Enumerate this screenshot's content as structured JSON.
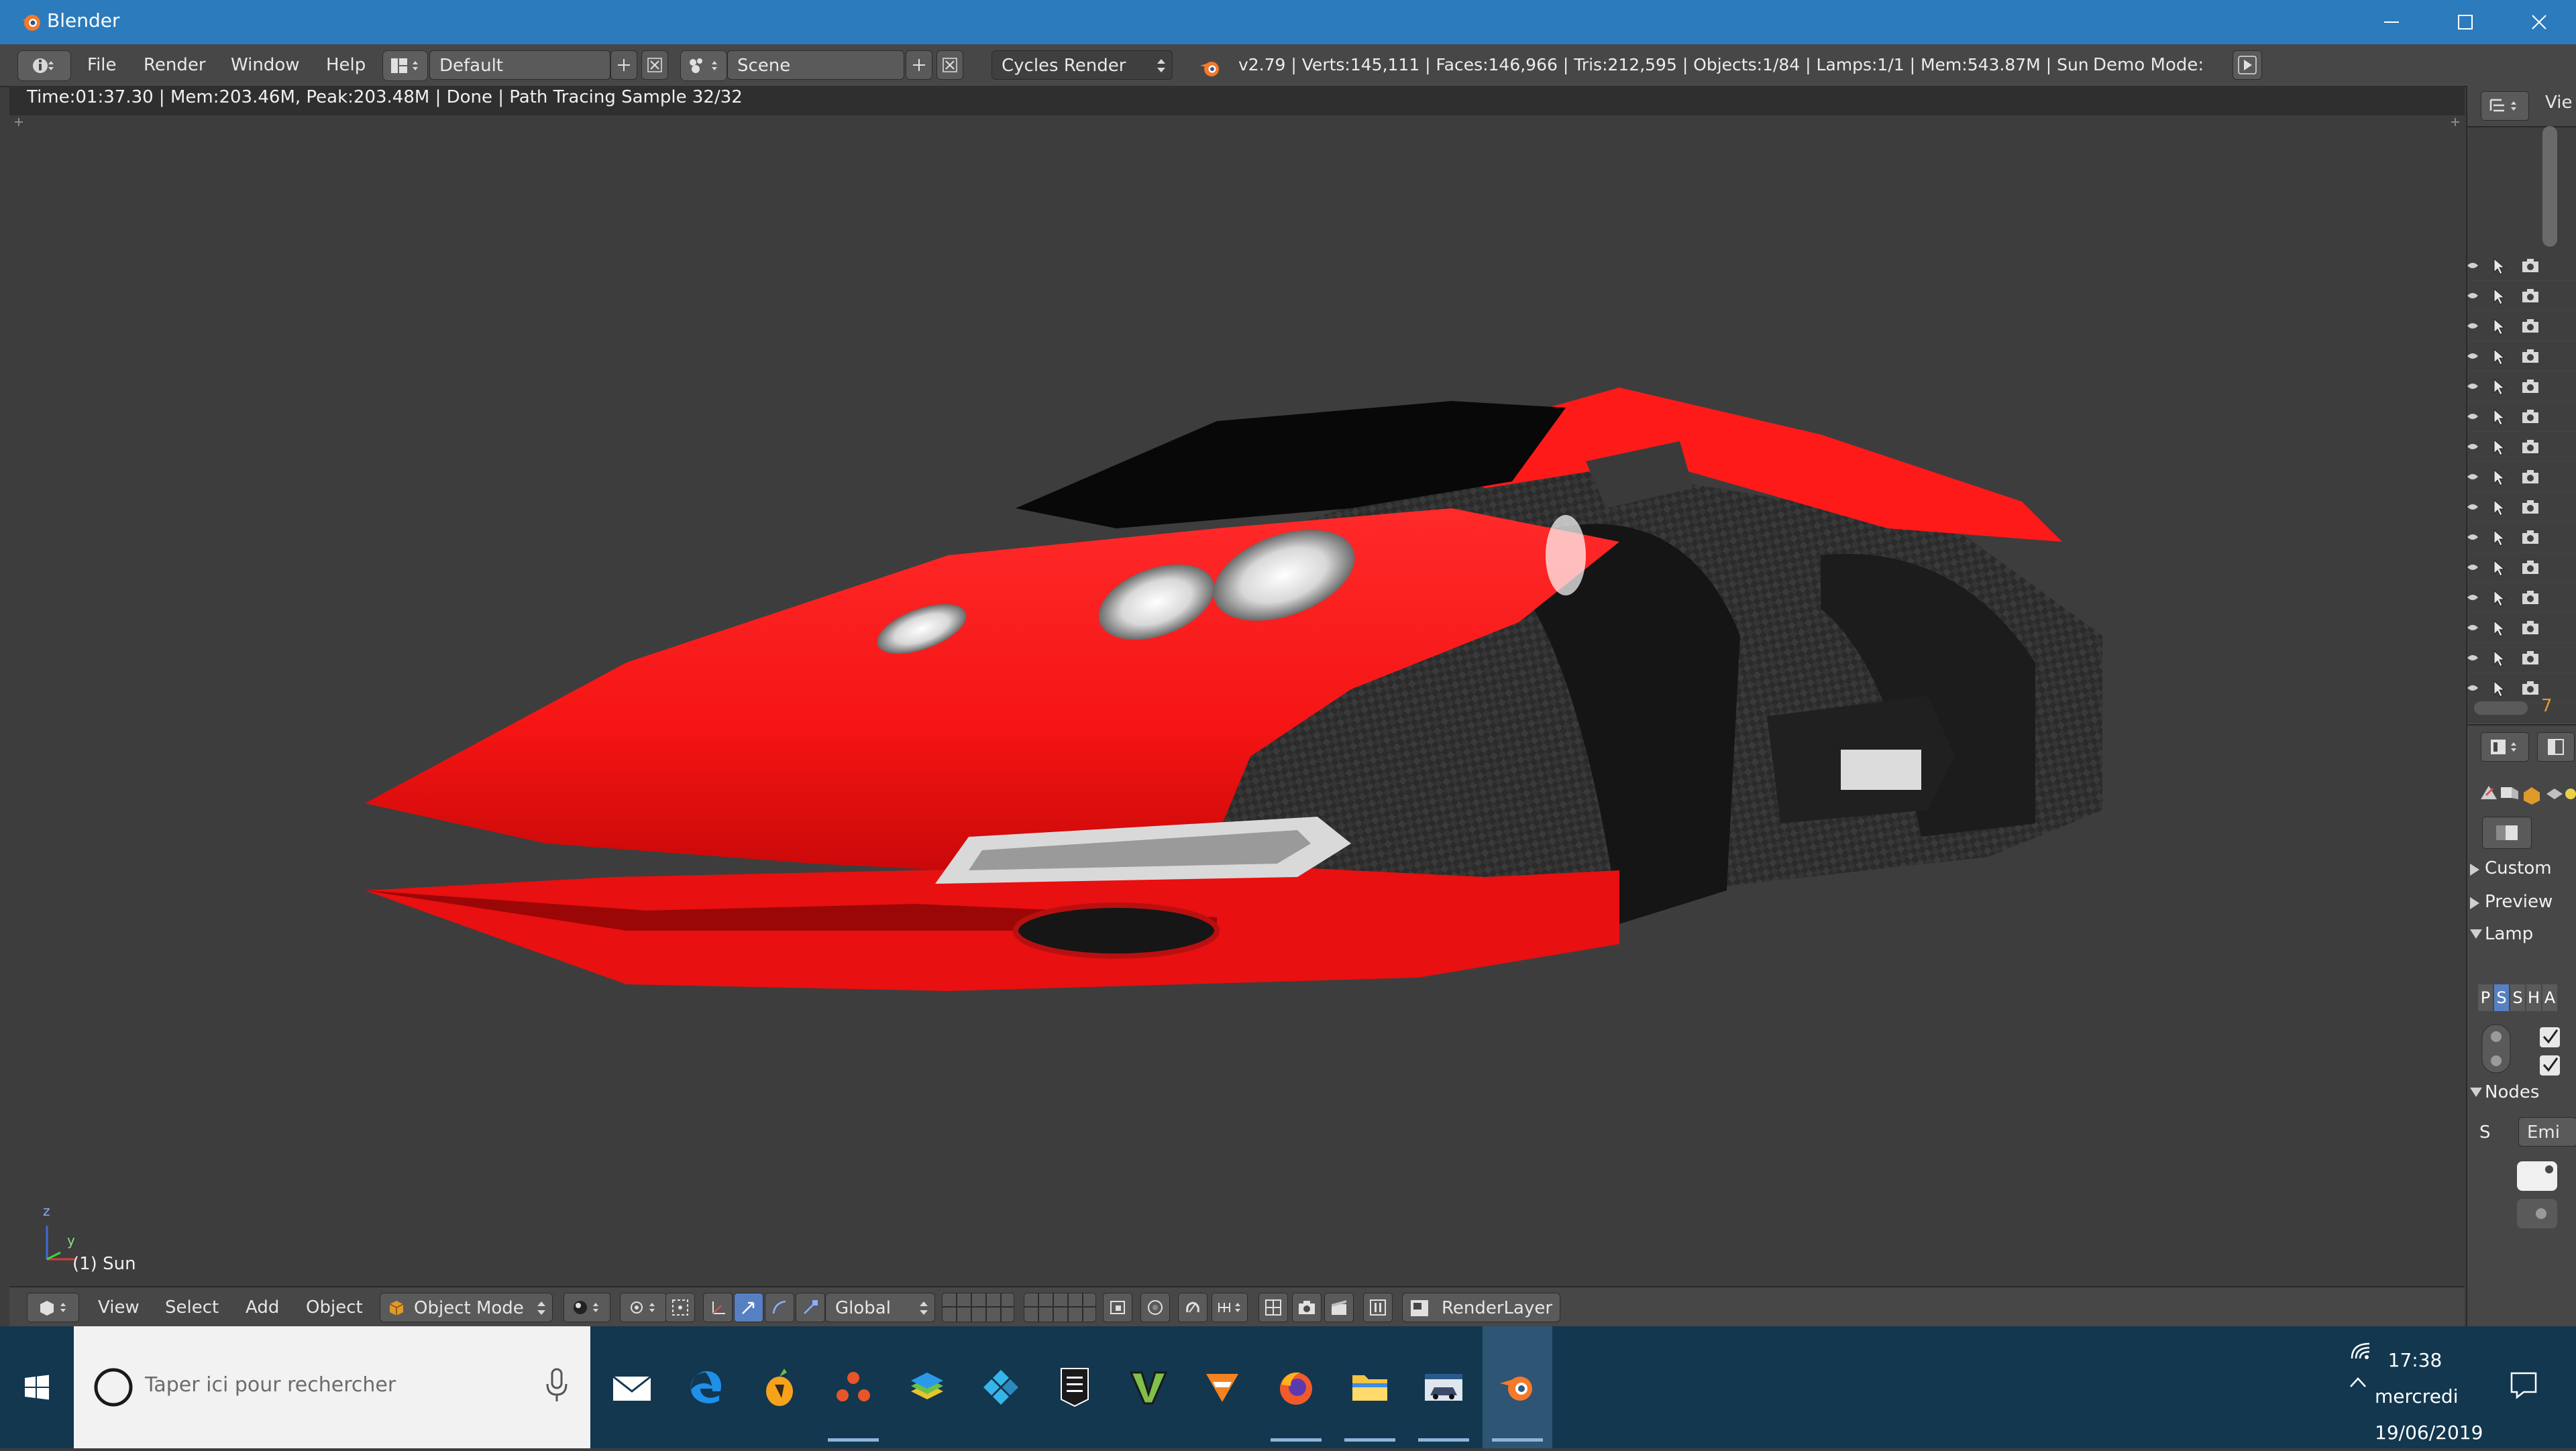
{
  "window": {
    "title": "Blender",
    "controls": [
      "minimize",
      "maximize",
      "close"
    ]
  },
  "info_header": {
    "menus": [
      "File",
      "Render",
      "Window",
      "Help"
    ],
    "screen_layout": "Default",
    "scene": "Scene",
    "render_engine": "Cycles Render",
    "stats": "v2.79 | Verts:145,111 | Faces:146,966 | Tris:212,595 | Objects:1/84 | Lamps:1/1 | Mem:543.87M | Sun",
    "demo_mode_label": "Demo Mode:"
  },
  "viewport": {
    "render_info": "Time:01:37.30 | Mem:203.46M, Peak:203.48M | Done | Path Tracing Sample 32/32",
    "object_label": "(1) Sun",
    "axis_labels": {
      "z": "z",
      "y": "y"
    },
    "colors": {
      "body_red": "#ff1a1a",
      "carbon": "#2b2b2b",
      "background": "#3d3d3d"
    }
  },
  "view3d_header": {
    "menus": [
      "View",
      "Select",
      "Add",
      "Object"
    ],
    "mode": "Object Mode",
    "orientation": "Global",
    "render_layer": "RenderLayer"
  },
  "outliner": {
    "header_label": "Vie",
    "footer_count": "7"
  },
  "properties": {
    "panels": [
      {
        "label": "Custom",
        "expanded": false
      },
      {
        "label": "Preview",
        "expanded": false
      },
      {
        "label": "Lamp",
        "expanded": true
      },
      {
        "label": "Nodes",
        "expanded": true
      }
    ],
    "lamp_types": [
      "P",
      "S",
      "S",
      "H",
      "A"
    ],
    "nodes_surface_label": "S",
    "nodes_surface_value": "Emi"
  },
  "taskbar": {
    "search_placeholder": "Taper ici pour rechercher",
    "apps": [
      "mail",
      "edge",
      "fl-studio",
      "davinci",
      "bluestacks",
      "kodi",
      "epic-games",
      "gta-v",
      "vlc",
      "firefox",
      "file-explorer",
      "car-game",
      "blender"
    ],
    "time": "17:38",
    "day": "mercredi",
    "date": "19/06/2019"
  }
}
